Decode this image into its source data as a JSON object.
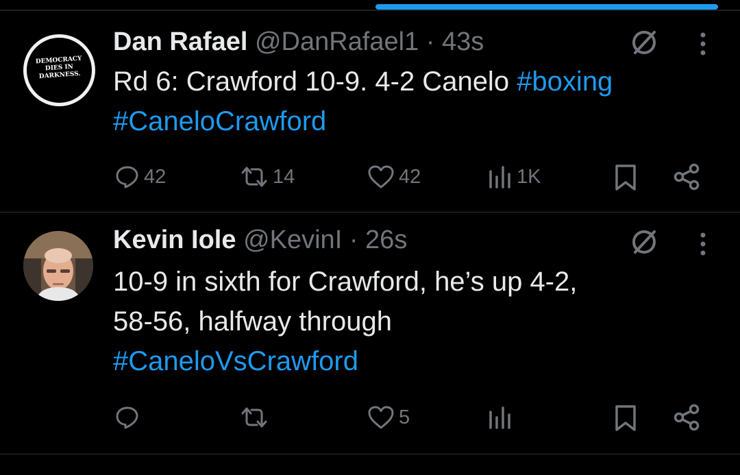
{
  "tweets": [
    {
      "display_name": "Dan Rafael",
      "handle": "@DanRafael1",
      "separator": "·",
      "time": "43s",
      "avatar_text": [
        "DEMOCRACY",
        "DIES IN",
        "DARKNESS."
      ],
      "text": "Rd 6: Crawford 10-9. 4-2 Canelo ",
      "hashtags": [
        "#boxing",
        "#CaneloCrawford"
      ],
      "replies": "42",
      "reposts": "14",
      "likes": "42",
      "views": "1K"
    },
    {
      "display_name": "Kevin Iole",
      "handle": "@KevinI",
      "separator": "·",
      "time": "26s",
      "text_lines": [
        "10-9 in sixth for Crawford, he’s up 4-2,",
        "58-56, halfway through"
      ],
      "hashtags": [
        "#CaneloVsCrawford"
      ],
      "replies": "",
      "reposts": "",
      "likes": "5",
      "views": ""
    }
  ],
  "colors": {
    "background": "#000000",
    "text": "#e7e9ea",
    "muted": "#71767b",
    "link": "#1d9bf0",
    "divider": "#2f3336"
  },
  "icons": [
    "grok-icon",
    "more-icon",
    "reply-icon",
    "repost-icon",
    "like-icon",
    "views-icon",
    "bookmark-icon",
    "share-icon"
  ]
}
